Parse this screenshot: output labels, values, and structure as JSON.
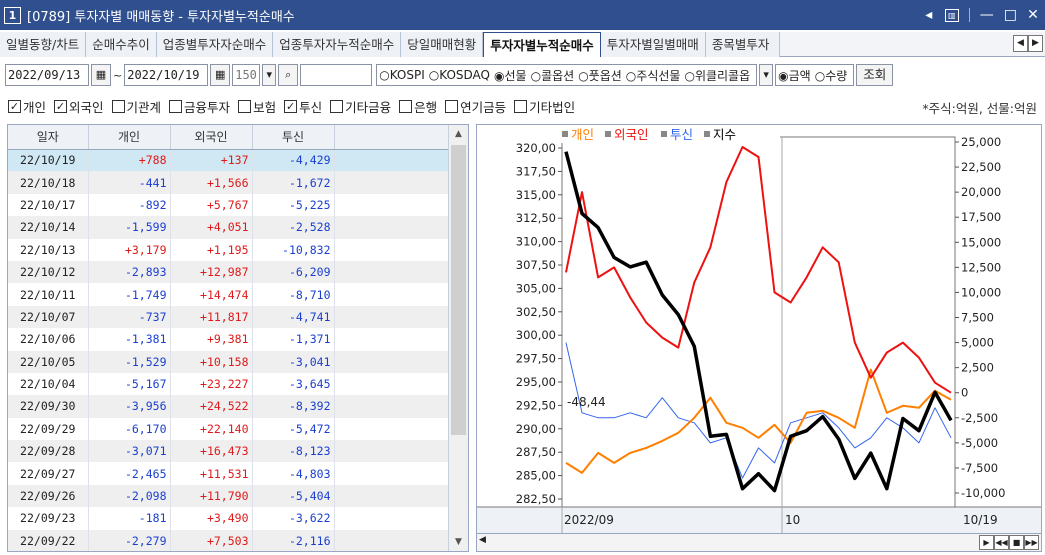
{
  "window": {
    "number": "1",
    "title": "[0789] 투자자별 매매동향 - 투자자별누적순매수",
    "controls": [
      "◂",
      "▥",
      "—",
      "□",
      "✕"
    ]
  },
  "tabs": [
    {
      "label": "일별동향/차트",
      "active": false
    },
    {
      "label": "순매수추이",
      "active": false
    },
    {
      "label": "업종별투자자순매수",
      "active": false
    },
    {
      "label": "업종투자자누적순매수",
      "active": false
    },
    {
      "label": "당일매매현황",
      "active": false
    },
    {
      "label": "투자자별누적순매수",
      "active": true
    },
    {
      "label": "투자자별일별매매",
      "active": false
    },
    {
      "label": "종목별투자",
      "active": false
    }
  ],
  "filters": {
    "start_date": "2022/09/13",
    "tilde": "~",
    "end_date": "2022/10/19",
    "count": "150",
    "search_value": "",
    "markets": [
      {
        "label": "KOSPI",
        "selected": false
      },
      {
        "label": "KOSDAQ",
        "selected": false
      },
      {
        "label": "선물",
        "selected": true
      },
      {
        "label": "콜옵션",
        "selected": false
      },
      {
        "label": "풋옵션",
        "selected": false
      },
      {
        "label": "주식선물",
        "selected": false
      },
      {
        "label": "위클리콜옵",
        "selected": false
      }
    ],
    "units": [
      {
        "label": "금액",
        "selected": true
      },
      {
        "label": "수량",
        "selected": false
      }
    ],
    "query_button": "조회"
  },
  "investors": [
    {
      "label": "개인",
      "checked": true
    },
    {
      "label": "외국인",
      "checked": true
    },
    {
      "label": "기관계",
      "checked": false
    },
    {
      "label": "금융투자",
      "checked": false
    },
    {
      "label": "보험",
      "checked": false
    },
    {
      "label": "투신",
      "checked": true
    },
    {
      "label": "기타금융",
      "checked": false
    },
    {
      "label": "은행",
      "checked": false
    },
    {
      "label": "연기금등",
      "checked": false
    },
    {
      "label": "기타법인",
      "checked": false
    }
  ],
  "unit_note": "*주식:억원, 선물:억원",
  "table": {
    "headers": [
      "일자",
      "개인",
      "외국인",
      "투신"
    ],
    "rows": [
      [
        "22/10/19",
        "+788",
        "+137",
        "-4,429"
      ],
      [
        "22/10/18",
        "-441",
        "+1,566",
        "-1,672"
      ],
      [
        "22/10/17",
        "-892",
        "+5,767",
        "-5,225"
      ],
      [
        "22/10/14",
        "-1,599",
        "+4,051",
        "-2,528"
      ],
      [
        "22/10/13",
        "+3,179",
        "+1,195",
        "-10,832"
      ],
      [
        "22/10/12",
        "-2,893",
        "+12,987",
        "-6,209"
      ],
      [
        "22/10/11",
        "-1,749",
        "+14,474",
        "-8,710"
      ],
      [
        "22/10/07",
        "-737",
        "+11,817",
        "-4,741"
      ],
      [
        "22/10/06",
        "-1,381",
        "+9,381",
        "-1,371"
      ],
      [
        "22/10/05",
        "-1,529",
        "+10,158",
        "-3,041"
      ],
      [
        "22/10/04",
        "-5,167",
        "+23,227",
        "-3,645"
      ],
      [
        "22/09/30",
        "-3,956",
        "+24,522",
        "-8,392"
      ],
      [
        "22/09/29",
        "-6,170",
        "+22,140",
        "-5,472"
      ],
      [
        "22/09/28",
        "-3,071",
        "+16,473",
        "-8,123"
      ],
      [
        "22/09/27",
        "-2,465",
        "+11,531",
        "-4,803"
      ],
      [
        "22/09/26",
        "-2,098",
        "+11,790",
        "-5,404"
      ],
      [
        "22/09/23",
        "-181",
        "+3,490",
        "-3,622"
      ],
      [
        "22/09/22",
        "-2,279",
        "+7,503",
        "-2,116"
      ]
    ]
  },
  "chart_data": {
    "type": "line",
    "legend": [
      {
        "name": "개인",
        "color": "#ff7f00"
      },
      {
        "name": "외국인",
        "color": "#ee1111"
      },
      {
        "name": "투신",
        "color": "#3366ee"
      },
      {
        "name": "지수",
        "color": "#000000"
      }
    ],
    "left_axis": {
      "ticks": [
        "320,00",
        "317,50",
        "315,00",
        "312,50",
        "310,00",
        "307,50",
        "305,00",
        "302,50",
        "300,00",
        "297,50",
        "295,00",
        "292,50",
        "290,00",
        "287,50",
        "285,00",
        "282,50"
      ],
      "range": [
        282.5,
        320.0
      ]
    },
    "right_axis": {
      "ticks": [
        "25,000",
        "22,500",
        "20,000",
        "17,500",
        "15,000",
        "12,500",
        "10,000",
        "7,500",
        "5,000",
        "2,500",
        "0",
        "-2,500",
        "-5,000",
        "-7,500",
        "-10,000"
      ],
      "range": [
        -10000,
        25000
      ]
    },
    "x_labels": [
      "2022/09",
      "10",
      "10/19"
    ],
    "annotation": "-48,44",
    "series": [
      {
        "name": "지수",
        "axis": "left",
        "color": "#000000",
        "values": [
          319.6,
          313.0,
          311.5,
          308.3,
          307.3,
          307.8,
          304.3,
          302.2,
          298.8,
          289.2,
          289.4,
          283.6,
          285.2,
          283.4,
          289.2,
          289.8,
          291.3,
          288.9,
          284.7,
          287.4,
          283.6,
          291.1,
          289.8,
          293.9,
          290.9
        ]
      },
      {
        "name": "외국인",
        "axis": "right",
        "color": "#ee1111",
        "values": [
          12000,
          20000,
          11500,
          12500,
          9500,
          7000,
          5500,
          4500,
          11000,
          14500,
          21000,
          24500,
          23500,
          10000,
          9000,
          11500,
          14500,
          13000,
          5000,
          1500,
          4000,
          5000,
          3500,
          1000,
          0
        ]
      },
      {
        "name": "개인",
        "axis": "right",
        "color": "#ff7f00",
        "values": [
          -7000,
          -8000,
          -6000,
          -7000,
          -6000,
          -5500,
          -4800,
          -4000,
          -2500,
          -500,
          -3000,
          -3500,
          -4500,
          -3200,
          -5000,
          -2000,
          -1800,
          -2500,
          -3500,
          2300,
          -2000,
          -1300,
          -1500,
          200,
          -700
        ]
      },
      {
        "name": "투신",
        "axis": "right",
        "color": "#3366ee",
        "values": [
          5000,
          -2000,
          -2500,
          -2500,
          -2000,
          -2500,
          -500,
          -2500,
          -3000,
          -5000,
          -4500,
          -8500,
          -5500,
          -7000,
          -3000,
          -2500,
          -2000,
          -3500,
          -5500,
          -4500,
          -2500,
          -3500,
          -5000,
          -1500,
          -4500
        ]
      }
    ]
  }
}
